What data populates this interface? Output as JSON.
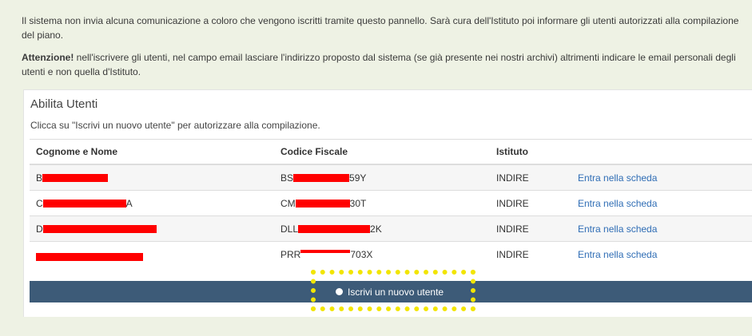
{
  "notice": {
    "line1": "Il sistema non invia alcuna comunicazione a coloro che vengono iscritti tramite questo pannello. Sarà cura dell'Istituto poi informare gli utenti autorizzati alla compilazione del piano.",
    "warning_bold": "Attenzione!",
    "warning_text": " nell'iscrivere gli utenti, nel campo email lasciare l'indirizzo proposto dal sistema (se già presente nei nostri archivi) altrimenti indicare le email personali degli utenti e non quella d'Istituto."
  },
  "panel": {
    "title": "Abilita Utenti",
    "subtitle": "Clicca su \"Iscrivi un nuovo utente\" per autorizzare alla compilazione."
  },
  "table": {
    "headers": [
      "Cognome e Nome",
      "Codice Fiscale",
      "Istituto",
      ""
    ],
    "rows": [
      {
        "name_visible": "B",
        "cf_prefix": "BS",
        "cf_suffix": "59Y",
        "istituto": "INDIRE",
        "action": "Entra nella scheda"
      },
      {
        "name_visible": "C",
        "name_tail": "A",
        "cf_prefix": "CM",
        "cf_suffix": "30T",
        "istituto": "INDIRE",
        "action": "Entra nella scheda"
      },
      {
        "name_visible": "D",
        "cf_prefix": "DLL",
        "cf_suffix": "2K",
        "istituto": "INDIRE",
        "action": "Entra nella scheda"
      },
      {
        "name_visible": "",
        "cf_prefix": "PRR",
        "cf_suffix": "703X",
        "istituto": "INDIRE",
        "action": "Entra nella scheda"
      }
    ]
  },
  "actions": {
    "add_user_label": "Iscrivi un nuovo utente"
  },
  "colors": {
    "background": "#eef2e4",
    "action_bar": "#3d5b78",
    "link": "#2f6db5",
    "redaction": "#ff0000",
    "highlight": "#f2e500"
  },
  "icons": {
    "add_user": "circle-icon"
  }
}
